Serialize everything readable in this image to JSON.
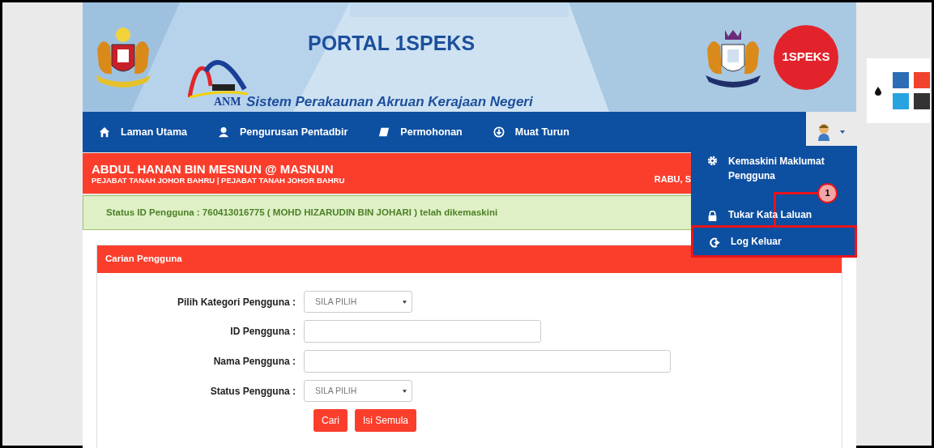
{
  "banner": {
    "title": "PORTAL 1SPEKS",
    "acronym": "ANM",
    "subtitle": "Sistem Perakaunan Akruan Kerajaan Negeri",
    "logo_text": "1SPEKS"
  },
  "nav": [
    {
      "label": "Laman Utama"
    },
    {
      "label": "Pengurusan Pentadbir"
    },
    {
      "label": "Permohonan"
    },
    {
      "label": "Muat Turun"
    }
  ],
  "user_bar": {
    "name": "ABDUL HANAN BIN MESNUN @ MASNUN",
    "office": "PEJABAT TANAH JOHOR BAHRU | PEJABAT TANAH JOHOR BAHRU",
    "date": "RABU, S"
  },
  "alert": "Status ID Pengguna : 760413016775 ( MOHD HIZARUDIN BIN JOHARI ) telah dikemaskini",
  "user_menu": {
    "expanded": true,
    "items": [
      {
        "label": "Kemaskini Maklumat Pengguna",
        "highlighted": false
      },
      {
        "label": "Tukar Kata Laluan",
        "highlighted": false
      },
      {
        "label": "Log Keluar",
        "highlighted": true
      }
    ]
  },
  "annotation": {
    "number": "1"
  },
  "palette": [
    {
      "color": "#2c6db5"
    },
    {
      "color": "#f0432d"
    },
    {
      "color": "#27a4e0"
    },
    {
      "color": "#333333"
    }
  ],
  "card": {
    "title": "Carian Pengguna",
    "fields": [
      {
        "kind": "select",
        "label": "Pilih Kategori Pengguna :",
        "value": "SILA PILIH"
      },
      {
        "kind": "text",
        "label": "ID Pengguna :"
      },
      {
        "kind": "text",
        "label": "Nama Pengguna :"
      },
      {
        "kind": "select",
        "label": "Status Pengguna :",
        "value": "SILA PILIH"
      }
    ],
    "buttons": [
      "Cari",
      "Isi Semula"
    ]
  }
}
